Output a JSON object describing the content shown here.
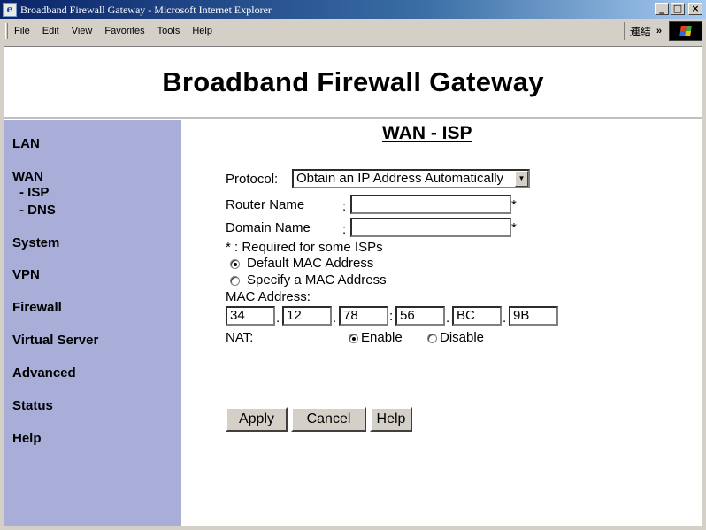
{
  "window": {
    "title": "Broadband Firewall Gateway - Microsoft Internet Explorer",
    "minimize": "_",
    "maximize": "□",
    "close": "×"
  },
  "menubar": {
    "items": [
      {
        "label": "File",
        "u": "F",
        "rest": "ile"
      },
      {
        "label": "Edit",
        "u": "E",
        "rest": "dit"
      },
      {
        "label": "View",
        "u": "V",
        "rest": "iew"
      },
      {
        "label": "Favorites",
        "u": "F",
        "rest": "avorites",
        "pre": "",
        "full": "Favorites"
      },
      {
        "label": "Tools",
        "u": "T",
        "rest": "ools"
      },
      {
        "label": "Help",
        "u": "H",
        "rest": "elp"
      }
    ],
    "links_label": "連結",
    "links_chevron": "»"
  },
  "header": {
    "title": "Broadband Firewall Gateway"
  },
  "sidebar": {
    "items": [
      {
        "label": "LAN"
      },
      {
        "label": "WAN"
      },
      {
        "label": "- ISP"
      },
      {
        "label": "- DNS"
      },
      {
        "label": "System"
      },
      {
        "label": "VPN"
      },
      {
        "label": "Firewall"
      },
      {
        "label": "Virtual Server"
      },
      {
        "label": "Advanced"
      },
      {
        "label": "Status"
      },
      {
        "label": "Help"
      }
    ]
  },
  "main": {
    "title": "WAN - ISP",
    "protocol_label": "Protocol:",
    "protocol_value": "Obtain an IP Address Automatically",
    "router_name_label": "Router Name",
    "domain_name_label": "Domain Name",
    "colon": ":",
    "required_mark": "*",
    "required_note": "* : Required for some ISPs",
    "mac_default_label": "Default MAC Address",
    "mac_default_selected": true,
    "mac_specify_label": "Specify a MAC Address",
    "mac_address_label": "MAC Address:",
    "mac_octets": [
      "34",
      "12",
      "78",
      "56",
      "BC",
      "9B"
    ],
    "mac_separators": [
      ".",
      ".",
      ":",
      ".",
      "."
    ],
    "nat_label": "NAT:",
    "nat_enable_label": "Enable",
    "nat_disable_label": "Disable",
    "nat_enabled": true,
    "buttons": {
      "apply": "Apply",
      "cancel": "Cancel",
      "help": "Help"
    }
  }
}
